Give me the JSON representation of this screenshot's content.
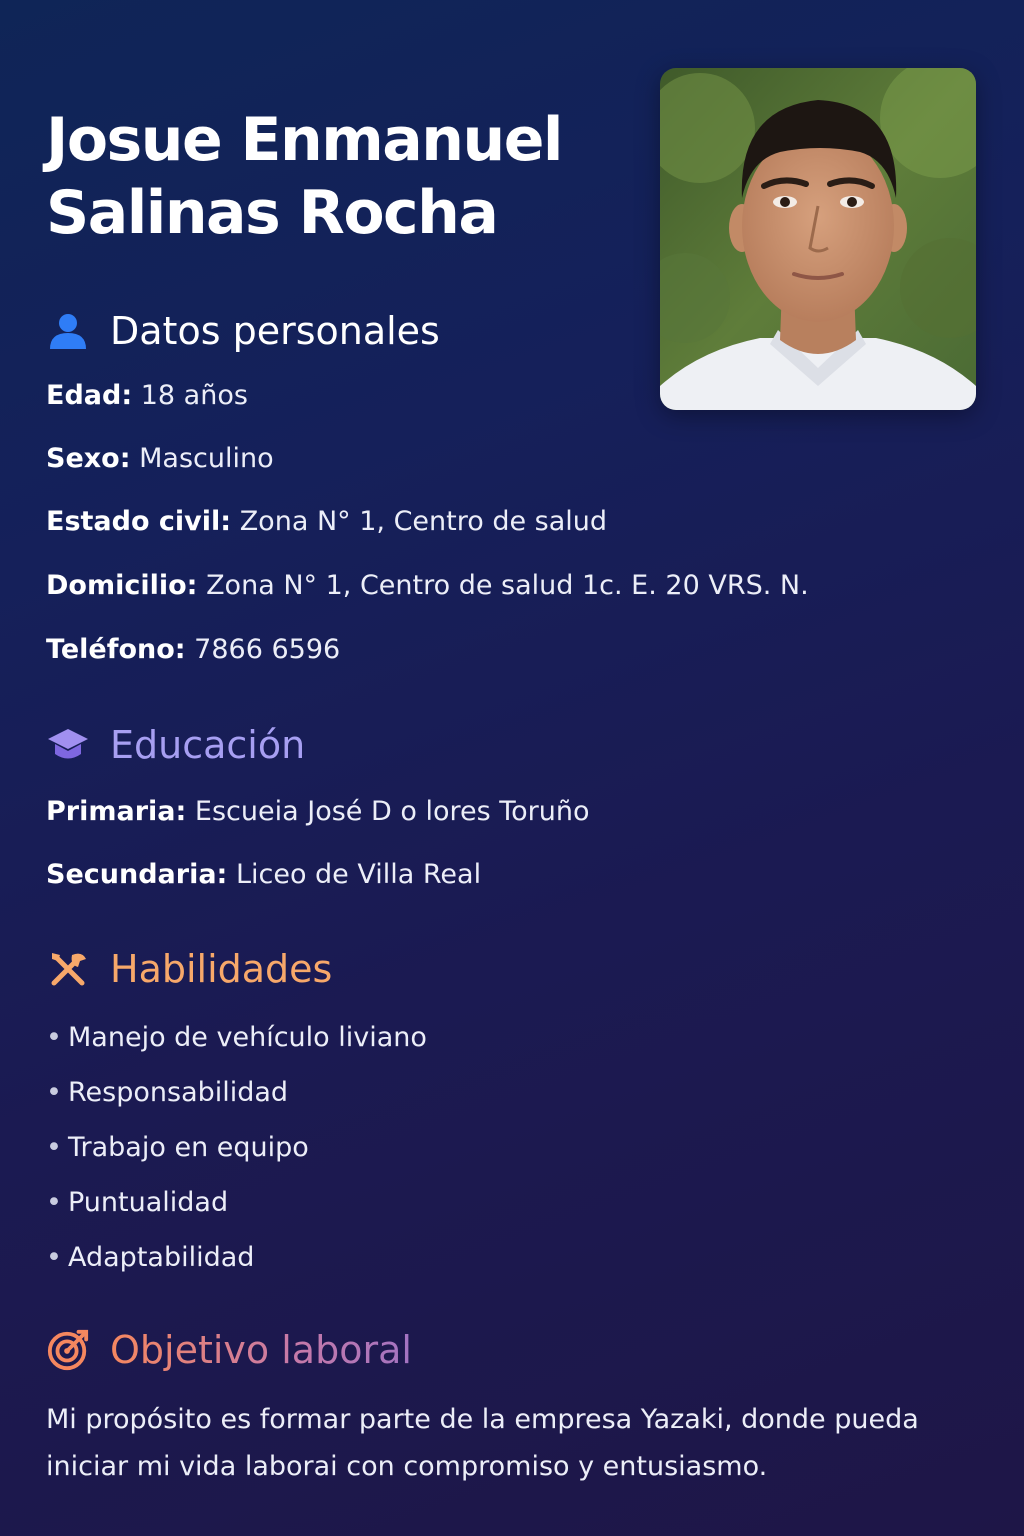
{
  "header": {
    "name_line1": "Josue Enmanuel",
    "name_line2": "Salinas Rocha"
  },
  "personal": {
    "title": "Datos personales",
    "icon": "person-icon",
    "fields": [
      {
        "label": "Edad:",
        "value": "18 años"
      },
      {
        "label": "Sexo:",
        "value": "Masculino"
      },
      {
        "label": "Estado civil:",
        "value": "Zona N° 1, Centro de salud"
      },
      {
        "label": "Domicilio:",
        "value": "Zona N° 1, Centro de salud 1c. E. 20 VRS. N."
      },
      {
        "label": "Teléfono:",
        "value": "7866 6596"
      }
    ]
  },
  "education": {
    "title": "Educación",
    "icon": "graduation-cap-icon",
    "fields": [
      {
        "label": "Primaria:",
        "value": "Escueia José D o lores Toruño"
      },
      {
        "label": "Secundaria:",
        "value": "Liceo de Villa Real"
      }
    ]
  },
  "skills": {
    "title": "Habilidades",
    "icon": "tools-icon",
    "items": [
      "Manejo de vehículo liviano",
      "Responsabilidad",
      "Trabajo en equipo",
      "Puntualidad",
      "Adaptabilidad"
    ]
  },
  "objective": {
    "title": "Objetivo laboral",
    "icon": "target-icon",
    "text": "Mi propósito es formar parte de la empresa Yazaki, donde pueda iniciar mi vida laborai con compromiso y entusiasmo."
  },
  "colors": {
    "personal_icon": "#2f7df6",
    "education": "#a79ff2",
    "skills": "#f7a86a",
    "objective": "#f5875f"
  }
}
